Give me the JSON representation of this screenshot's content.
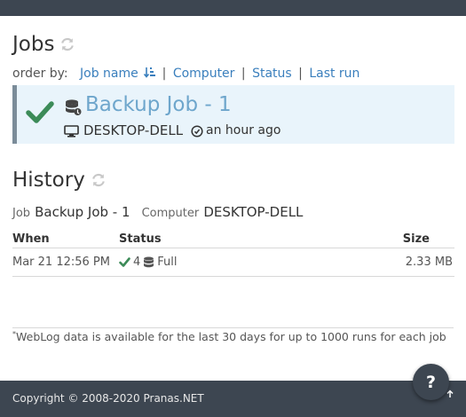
{
  "jobs": {
    "title": "Jobs",
    "order_by": {
      "label": "order by:",
      "options": [
        "Job name",
        "Computer",
        "Status",
        "Last run"
      ]
    },
    "items": [
      {
        "name": "Backup Job - 1",
        "computer": "DESKTOP-DELL",
        "last_run": "an hour ago",
        "status": "success"
      }
    ]
  },
  "history": {
    "title": "History",
    "job_label": "Job",
    "job_value": "Backup Job - 1",
    "computer_label": "Computer",
    "computer_value": "DESKTOP-DELL",
    "columns": [
      "When",
      "Status",
      "Size"
    ],
    "rows": [
      {
        "when": "Mar 21 12:56 PM",
        "status_count": "4",
        "type": "Full",
        "size": "2.33 MB"
      }
    ]
  },
  "footnote": {
    "marker": "*",
    "text": "WebLog data is available for the last 30 days for up to 1000 runs for each job"
  },
  "footer": {
    "copyright": "Copyright © 2008-2020 Pranas.NET",
    "help_label": "?"
  },
  "colors": {
    "bar": "#3d4651",
    "accent_link": "#3a7fbd",
    "job_name": "#6ea6cc",
    "success": "#3c8b58",
    "card_bg": "#e9f4fb"
  }
}
